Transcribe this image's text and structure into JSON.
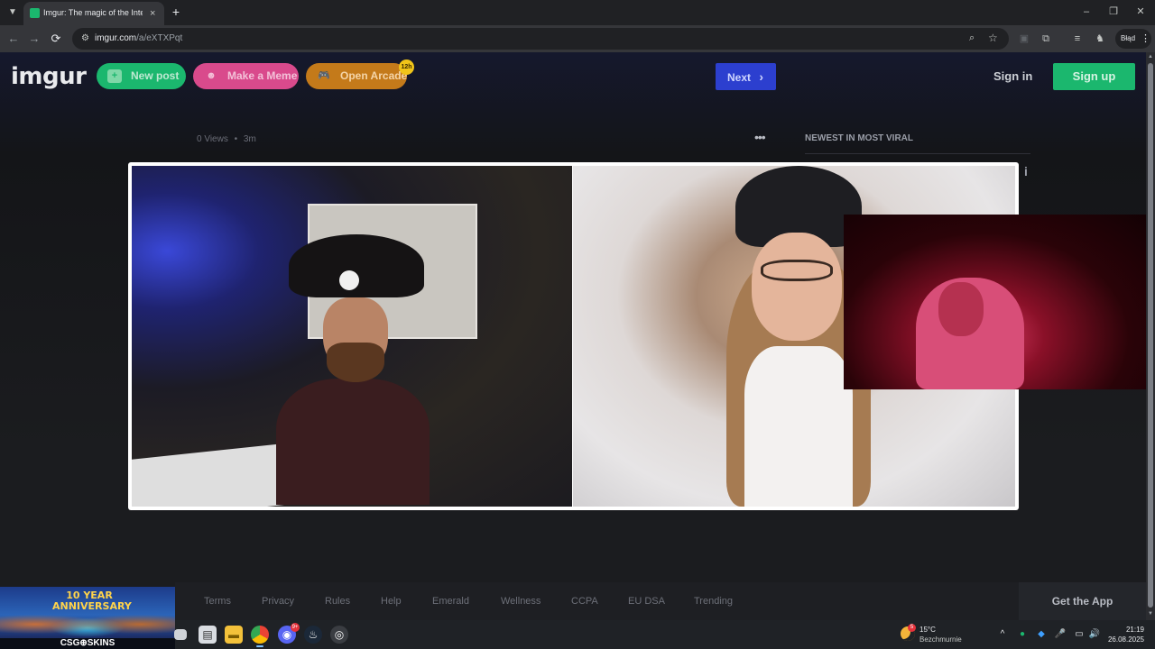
{
  "browser": {
    "tab_title": "Imgur: The magic of the Interne",
    "tab_close": "×",
    "new_tab": "+",
    "url_domain": "imgur.com",
    "url_path": "/a/eXTXPqt",
    "profile_label": "Błąd",
    "controls": {
      "minimize": "–",
      "restore": "❐",
      "close": "✕"
    },
    "icons": {
      "back": "←",
      "forward": "→",
      "reload": "⟳",
      "site_info": "⚙",
      "zoom": "⌕",
      "bookmark": "☆",
      "extensions": "⧉",
      "tab_search": "⌄",
      "menu": "⋮",
      "side_panel": "≡",
      "cast": "▣"
    }
  },
  "header": {
    "logo": "imgur",
    "new_post": "New post",
    "make_meme": "Make a Meme",
    "open_arcade": "Open Arcade",
    "arcade_badge": "12h",
    "next": "Next",
    "next_chevron": "›",
    "sign_in": "Sign in",
    "sign_up": "Sign up",
    "icons": {
      "new_post": "+",
      "meme": "☻",
      "arcade": "🎮"
    }
  },
  "post": {
    "views": "0 Views",
    "separator": "•",
    "age": "3m",
    "more": "•••"
  },
  "sidebar": {
    "heading": "NEWEST IN MOST VIRAL",
    "info": "i"
  },
  "footer": {
    "links": [
      "Terms",
      "Privacy",
      "Rules",
      "Help",
      "Emerald",
      "Wellness",
      "CCPA",
      "EU DSA",
      "Trending"
    ],
    "get_app": "Get the App"
  },
  "ad": {
    "anniversary": "10 YEAR ANNIVERSARY",
    "brand": "CSG⊕SKINS"
  },
  "taskbar": {
    "discord_badge": "9+",
    "weather": {
      "badge": "5",
      "temp": "15°C",
      "location": "Bezchmurnie"
    },
    "time": "21:19",
    "date": "26.08.2025",
    "tray": {
      "chevron": "^",
      "mic": "🎤",
      "display": "▭",
      "volume": "🔊"
    }
  },
  "colors": {
    "green": "#1bb76e",
    "pink": "#d94a8c",
    "orange": "#c47a1a",
    "next_blue": "#2c3fcf"
  }
}
